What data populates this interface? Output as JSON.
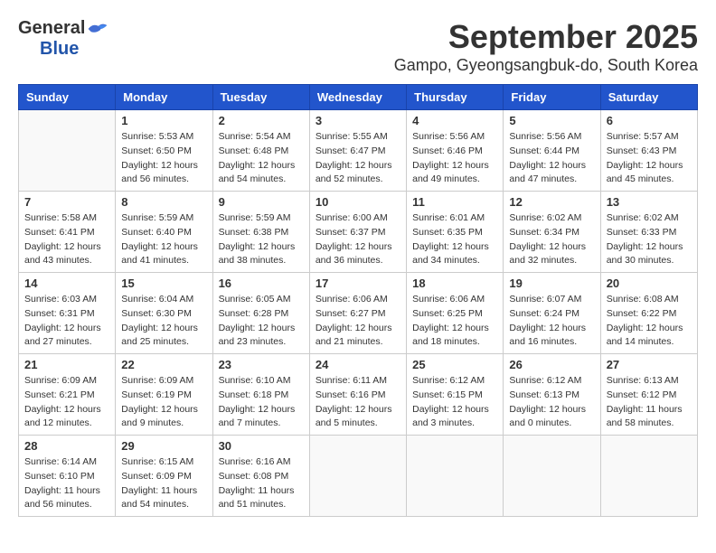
{
  "logo": {
    "general": "General",
    "blue": "Blue"
  },
  "title": {
    "month": "September 2025",
    "location": "Gampo, Gyeongsangbuk-do, South Korea"
  },
  "headers": [
    "Sunday",
    "Monday",
    "Tuesday",
    "Wednesday",
    "Thursday",
    "Friday",
    "Saturday"
  ],
  "weeks": [
    [
      {
        "day": "",
        "info": ""
      },
      {
        "day": "1",
        "info": "Sunrise: 5:53 AM\nSunset: 6:50 PM\nDaylight: 12 hours\nand 56 minutes."
      },
      {
        "day": "2",
        "info": "Sunrise: 5:54 AM\nSunset: 6:48 PM\nDaylight: 12 hours\nand 54 minutes."
      },
      {
        "day": "3",
        "info": "Sunrise: 5:55 AM\nSunset: 6:47 PM\nDaylight: 12 hours\nand 52 minutes."
      },
      {
        "day": "4",
        "info": "Sunrise: 5:56 AM\nSunset: 6:46 PM\nDaylight: 12 hours\nand 49 minutes."
      },
      {
        "day": "5",
        "info": "Sunrise: 5:56 AM\nSunset: 6:44 PM\nDaylight: 12 hours\nand 47 minutes."
      },
      {
        "day": "6",
        "info": "Sunrise: 5:57 AM\nSunset: 6:43 PM\nDaylight: 12 hours\nand 45 minutes."
      }
    ],
    [
      {
        "day": "7",
        "info": "Sunrise: 5:58 AM\nSunset: 6:41 PM\nDaylight: 12 hours\nand 43 minutes."
      },
      {
        "day": "8",
        "info": "Sunrise: 5:59 AM\nSunset: 6:40 PM\nDaylight: 12 hours\nand 41 minutes."
      },
      {
        "day": "9",
        "info": "Sunrise: 5:59 AM\nSunset: 6:38 PM\nDaylight: 12 hours\nand 38 minutes."
      },
      {
        "day": "10",
        "info": "Sunrise: 6:00 AM\nSunset: 6:37 PM\nDaylight: 12 hours\nand 36 minutes."
      },
      {
        "day": "11",
        "info": "Sunrise: 6:01 AM\nSunset: 6:35 PM\nDaylight: 12 hours\nand 34 minutes."
      },
      {
        "day": "12",
        "info": "Sunrise: 6:02 AM\nSunset: 6:34 PM\nDaylight: 12 hours\nand 32 minutes."
      },
      {
        "day": "13",
        "info": "Sunrise: 6:02 AM\nSunset: 6:33 PM\nDaylight: 12 hours\nand 30 minutes."
      }
    ],
    [
      {
        "day": "14",
        "info": "Sunrise: 6:03 AM\nSunset: 6:31 PM\nDaylight: 12 hours\nand 27 minutes."
      },
      {
        "day": "15",
        "info": "Sunrise: 6:04 AM\nSunset: 6:30 PM\nDaylight: 12 hours\nand 25 minutes."
      },
      {
        "day": "16",
        "info": "Sunrise: 6:05 AM\nSunset: 6:28 PM\nDaylight: 12 hours\nand 23 minutes."
      },
      {
        "day": "17",
        "info": "Sunrise: 6:06 AM\nSunset: 6:27 PM\nDaylight: 12 hours\nand 21 minutes."
      },
      {
        "day": "18",
        "info": "Sunrise: 6:06 AM\nSunset: 6:25 PM\nDaylight: 12 hours\nand 18 minutes."
      },
      {
        "day": "19",
        "info": "Sunrise: 6:07 AM\nSunset: 6:24 PM\nDaylight: 12 hours\nand 16 minutes."
      },
      {
        "day": "20",
        "info": "Sunrise: 6:08 AM\nSunset: 6:22 PM\nDaylight: 12 hours\nand 14 minutes."
      }
    ],
    [
      {
        "day": "21",
        "info": "Sunrise: 6:09 AM\nSunset: 6:21 PM\nDaylight: 12 hours\nand 12 minutes."
      },
      {
        "day": "22",
        "info": "Sunrise: 6:09 AM\nSunset: 6:19 PM\nDaylight: 12 hours\nand 9 minutes."
      },
      {
        "day": "23",
        "info": "Sunrise: 6:10 AM\nSunset: 6:18 PM\nDaylight: 12 hours\nand 7 minutes."
      },
      {
        "day": "24",
        "info": "Sunrise: 6:11 AM\nSunset: 6:16 PM\nDaylight: 12 hours\nand 5 minutes."
      },
      {
        "day": "25",
        "info": "Sunrise: 6:12 AM\nSunset: 6:15 PM\nDaylight: 12 hours\nand 3 minutes."
      },
      {
        "day": "26",
        "info": "Sunrise: 6:12 AM\nSunset: 6:13 PM\nDaylight: 12 hours\nand 0 minutes."
      },
      {
        "day": "27",
        "info": "Sunrise: 6:13 AM\nSunset: 6:12 PM\nDaylight: 11 hours\nand 58 minutes."
      }
    ],
    [
      {
        "day": "28",
        "info": "Sunrise: 6:14 AM\nSunset: 6:10 PM\nDaylight: 11 hours\nand 56 minutes."
      },
      {
        "day": "29",
        "info": "Sunrise: 6:15 AM\nSunset: 6:09 PM\nDaylight: 11 hours\nand 54 minutes."
      },
      {
        "day": "30",
        "info": "Sunrise: 6:16 AM\nSunset: 6:08 PM\nDaylight: 11 hours\nand 51 minutes."
      },
      {
        "day": "",
        "info": ""
      },
      {
        "day": "",
        "info": ""
      },
      {
        "day": "",
        "info": ""
      },
      {
        "day": "",
        "info": ""
      }
    ]
  ]
}
